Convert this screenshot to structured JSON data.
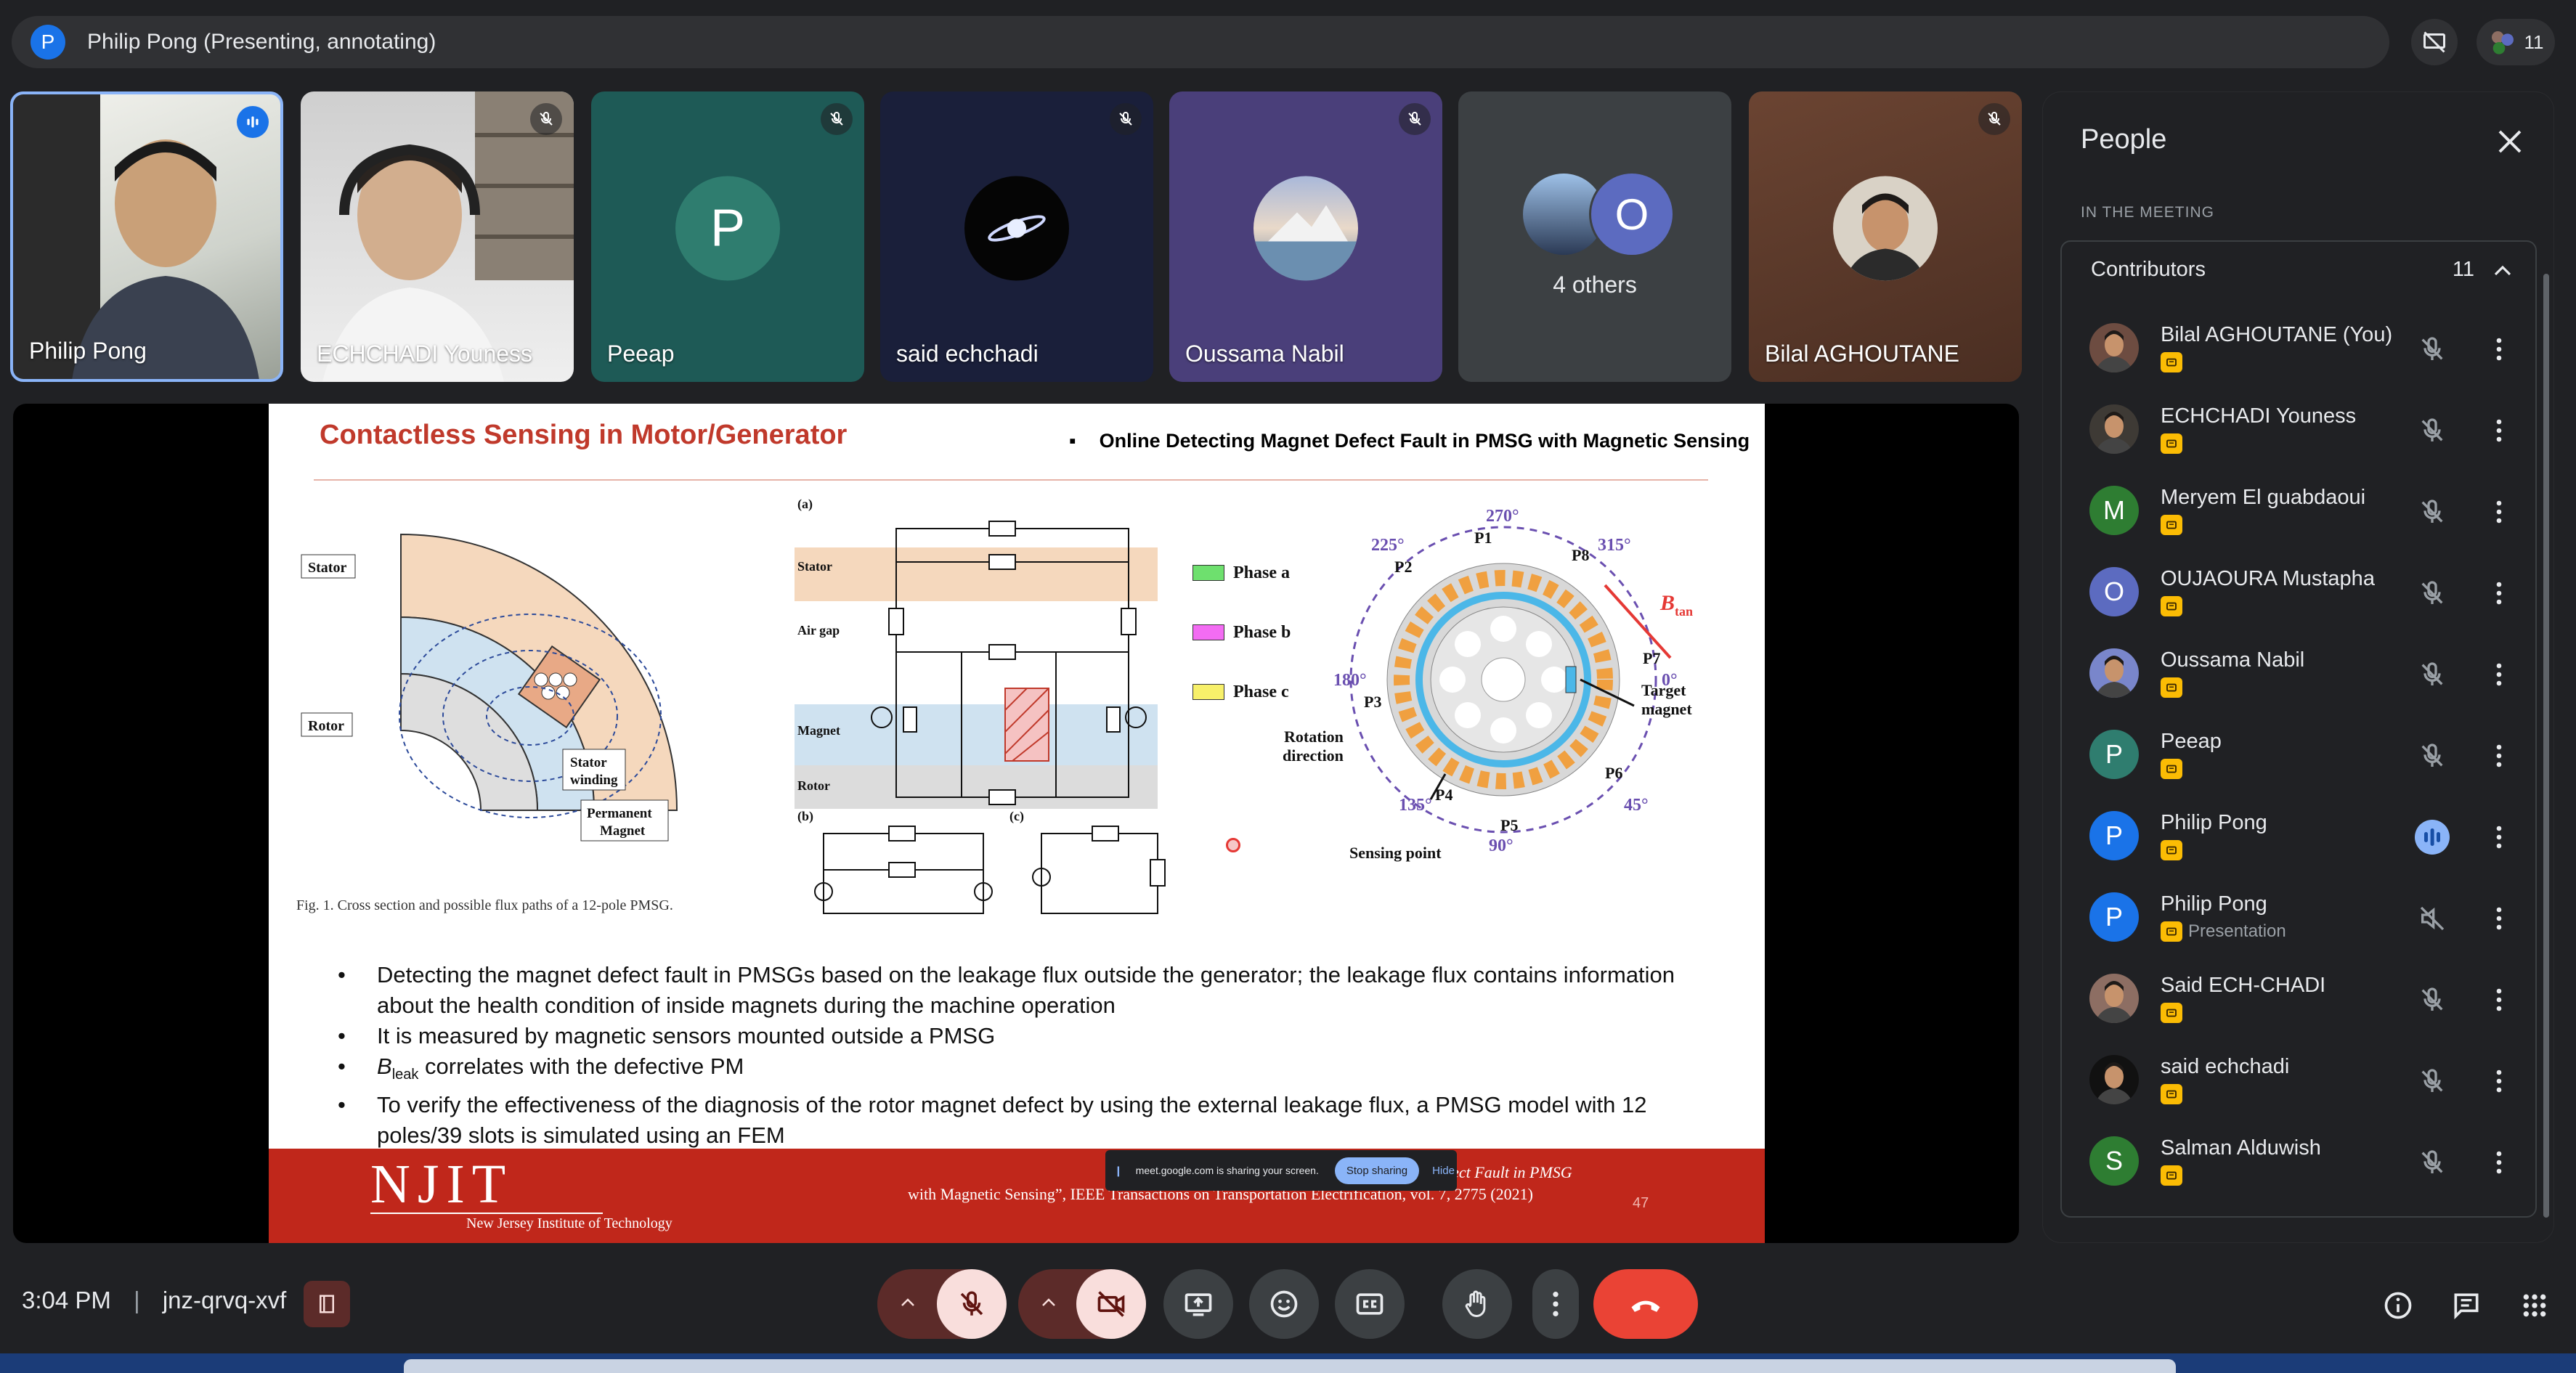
{
  "meeting": {
    "presenter_initial": "P",
    "presenter_title": "Philip Pong (Presenting, annotating)",
    "participant_count": "11",
    "time": "3:04 PM",
    "separator": "|",
    "code": "jnz-qrvq-xvf"
  },
  "tiles": [
    {
      "name": "Philip Pong",
      "type": "video",
      "speaking": true
    },
    {
      "name": "ECHCHADI Youness",
      "type": "video"
    },
    {
      "name": "Peeap",
      "initial": "P",
      "bg": "#1e5a56",
      "avatar_color": "#2f7d6f"
    },
    {
      "name": "said echchadi",
      "bg": "#1a1f3a"
    },
    {
      "name": "Oussama Nabil",
      "bg": "#4a3f7a"
    },
    {
      "name": "4 others",
      "initial": "O",
      "avatar_color": "#5c6bc0"
    },
    {
      "name": "Bilal AGHOUTANE",
      "bg": "#5a3a2a"
    }
  ],
  "slide": {
    "title": "Contactless Sensing in Motor/Generator",
    "subtitle_bullet": "▪",
    "subtitle": "Online Detecting Magnet Defect Fault in PMSG with Magnetic Sensing",
    "fig_caption": "Fig. 1.   Cross section and possible flux paths of a 12-pole PMSG.",
    "labels": {
      "stator": "Stator",
      "rotor": "Rotor",
      "stator_winding": "Stator winding",
      "permanent_magnet": "Permanent Magnet",
      "a": "(a)",
      "b": "(b)",
      "c": "(c)",
      "stator2": "Stator",
      "airgap": "Air gap",
      "magnet": "Magnet",
      "rotor2": "Rotor",
      "phase_a": "Phase a",
      "phase_b": "Phase b",
      "phase_c": "Phase c",
      "rotation": "Rotation direction",
      "sensing": "Sensing point",
      "target": "Target magnet",
      "btan": "B",
      "btan_sub": "tan",
      "deg270": "270°",
      "deg315": "315°",
      "deg225": "225°",
      "deg180": "180°",
      "deg0": "0°",
      "deg135": "135°",
      "deg90": "90°",
      "deg45": "45°",
      "p1": "P1",
      "p2": "P2",
      "p3": "P3",
      "p4": "P4",
      "p5": "P5",
      "p6": "P6",
      "p7": "P7",
      "p8": "P8"
    },
    "bullets": [
      "Detecting the magnet defect fault in PMSGs based on the leakage flux outside the generator; the leakage flux contains information about the health condition of inside magnets during the machine operation",
      "It is measured by magnetic sensors mounted outside a PMSG",
      "correlates with the defective PM",
      "To verify the effectiveness of the diagnosis of the rotor magnet defect by using the external leakage flux, a PMSG model with 12 poles/39 slots is simulated using an FEM"
    ],
    "b_leak": "B",
    "b_leak_sub": "leak",
    "njit": "NJIT",
    "njit_sub": "New Jersey Institute of Technology",
    "citation_1": "ong, C. Liu, “Online Detecting Magnet Defect Fault in PMSG",
    "citation_2": "with Magnetic Sensing”, IEEE Transactions on Transportation Electrification, vol. 7, 2775 (2021)",
    "page_number": "47",
    "share_text": "meet.google.com is sharing your screen.",
    "stop_sharing": "Stop sharing",
    "hide": "Hide"
  },
  "people": {
    "title": "People",
    "section": "IN THE MEETING",
    "group": "Contributors",
    "count": "11",
    "list": [
      {
        "name": "Bilal AGHOUTANE (You)",
        "avatar": "photo",
        "color": "#6d4c41"
      },
      {
        "name": "ECHCHADI Youness",
        "avatar": "photo",
        "color": "#3e3a35"
      },
      {
        "name": "Meryem El guabdaoui",
        "initial": "M",
        "color": "#2e7d32"
      },
      {
        "name": "OUJAOURA Mustapha",
        "initial": "O",
        "color": "#5c6bc0"
      },
      {
        "name": "Oussama Nabil",
        "avatar": "photo",
        "color": "#7986cb"
      },
      {
        "name": "Peeap",
        "initial": "P",
        "color": "#2f7d6f"
      },
      {
        "name": "Philip Pong",
        "initial": "P",
        "color": "#1a73e8",
        "speaking": true
      },
      {
        "name": "Philip Pong",
        "initial": "P",
        "color": "#1a73e8",
        "sub": "Presentation"
      },
      {
        "name": "Said ECH-CHADI",
        "avatar": "photo",
        "color": "#8d6e63"
      },
      {
        "name": "said echchadi",
        "avatar": "photo",
        "color": "#111"
      },
      {
        "name": "Salman Alduwish",
        "initial": "S",
        "color": "#2e7d32"
      }
    ]
  },
  "colors": {
    "accent": "#8ab4f8",
    "end_call": "#ea4335",
    "badge": "#fbbc04",
    "slide_red": "#c0271b"
  }
}
